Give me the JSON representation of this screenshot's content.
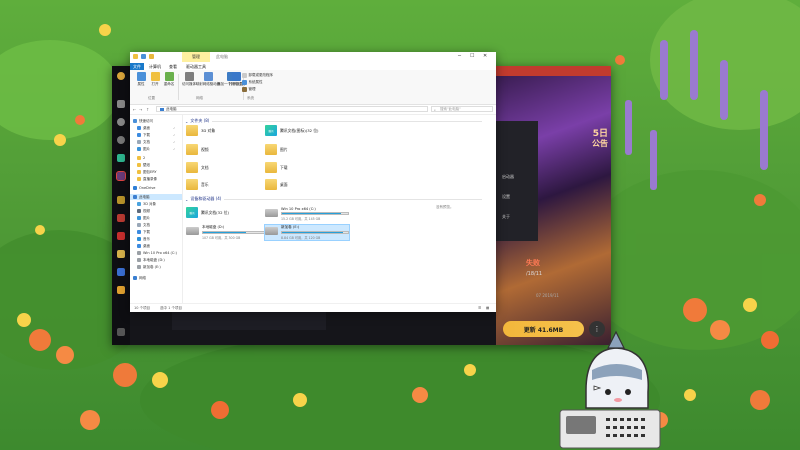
{
  "explorer": {
    "title": "此电脑",
    "context_tab": "管理",
    "ribbon_tabs": [
      "文件",
      "计算机",
      "查看",
      "驱动器工具"
    ],
    "ribbon_buttons": [
      {
        "label": "属性",
        "color": "#4a90d9"
      },
      {
        "label": "打开",
        "color": "#f0c040"
      },
      {
        "label": "重命名",
        "color": "#6ab04c"
      },
      {
        "label": "访问媒体",
        "color": "#7d7d7d"
      },
      {
        "label": "映射网络驱动器",
        "color": "#5b8fd4"
      },
      {
        "label": "添加一个网络位置",
        "color": "#3c7bc4"
      },
      {
        "label": "打开设置",
        "color": "#3a78c9"
      }
    ],
    "ribbon_small": [
      {
        "label": "卸载或更改程序",
        "color": "#c9c9c9"
      },
      {
        "label": "系统属性",
        "color": "#4a90d9"
      },
      {
        "label": "管理",
        "color": "#8a6d3b"
      }
    ],
    "ribbon_groups": [
      "位置",
      "网络",
      "系统"
    ],
    "address": "此电脑",
    "search_placeholder": "搜索\"此电脑\"",
    "nav_items": [
      {
        "label": "快速访问",
        "color": "#4a90d9"
      },
      {
        "label": "桌面",
        "color": "#3c8be0"
      },
      {
        "label": "下载",
        "color": "#3c8be0"
      },
      {
        "label": "文档",
        "color": "#9aa8b8"
      },
      {
        "label": "图片",
        "color": "#3b94d9"
      },
      {
        "label": "2",
        "color": "#f0c040"
      },
      {
        "label": "壁纸",
        "color": "#f0c040"
      },
      {
        "label": "图包ERY",
        "color": "#f0c040"
      },
      {
        "label": "直播录像",
        "color": "#f0c040"
      },
      {
        "label": "OneDrive",
        "color": "#2f7fd6"
      },
      {
        "label": "此电脑",
        "color": "#3a7fd1"
      },
      {
        "label": "3D 对象",
        "color": "#4aa3df"
      },
      {
        "label": "视频",
        "color": "#5e6b7c"
      },
      {
        "label": "图片",
        "color": "#3b94d9"
      },
      {
        "label": "文档",
        "color": "#9aa8b8"
      },
      {
        "label": "下载",
        "color": "#3c8be0"
      },
      {
        "label": "音乐",
        "color": "#2d8fd8"
      },
      {
        "label": "桌面",
        "color": "#3c8be0"
      },
      {
        "label": "Win 10 Pro x64 (C:)",
        "color": "#9aa0a6"
      },
      {
        "label": "本地磁盘 (D:)",
        "color": "#9aa0a6"
      },
      {
        "label": "新加卷 (E:)",
        "color": "#9aa0a6"
      },
      {
        "label": "网络",
        "color": "#3a7fd1"
      }
    ],
    "folders_header": "文件夹 (8)",
    "folders": [
      {
        "label": "3D 对象",
        "kind": "folder"
      },
      {
        "label": "腾讯文档(图标)(32 位)",
        "kind": "app",
        "tile": "腾讯"
      },
      {
        "label": "视频",
        "kind": "folder"
      },
      {
        "label": "图片",
        "kind": "folder"
      },
      {
        "label": "文档",
        "kind": "folder"
      },
      {
        "label": "下载",
        "kind": "folder"
      },
      {
        "label": "音乐",
        "kind": "folder"
      },
      {
        "label": "桌面",
        "kind": "folder"
      }
    ],
    "devices_header": "设备和驱动器 (4)",
    "devices": [
      {
        "label": "腾讯文档(32 位)",
        "kind": "app",
        "tile": "腾讯"
      },
      {
        "label": "Win 10 Pro x64 (C:)",
        "free": "15.2 GB 可用，共 145 GB",
        "used_fraction": 0.9,
        "kind": "drive"
      },
      {
        "label": "本地磁盘 (D:)",
        "free": "107 GB 可用，共 300 GB",
        "used_fraction": 0.65,
        "kind": "drive"
      },
      {
        "label": "新加卷 (E:)",
        "free": "8.84 GB 可用，共 120 GB",
        "used_fraction": 0.93,
        "kind": "drive"
      }
    ],
    "info_text": "没有预览。",
    "status_items": "10 个项目",
    "status_selected": "选中 1 个项目"
  },
  "launcher": {
    "promo_line1": "5日",
    "promo_line2": "公告",
    "fail_text": "失败",
    "date_text": "/18/11",
    "date2_text": "07 2019/11",
    "panel_items": [
      "启动器",
      "设置",
      "关于"
    ],
    "update_label": "更新 41.6MB",
    "more_label": "⋮"
  },
  "colors": {
    "accent": "#1979ca",
    "select": "#cce8ff",
    "launcher_bg": "#15151a",
    "update": "#f3b73b"
  }
}
